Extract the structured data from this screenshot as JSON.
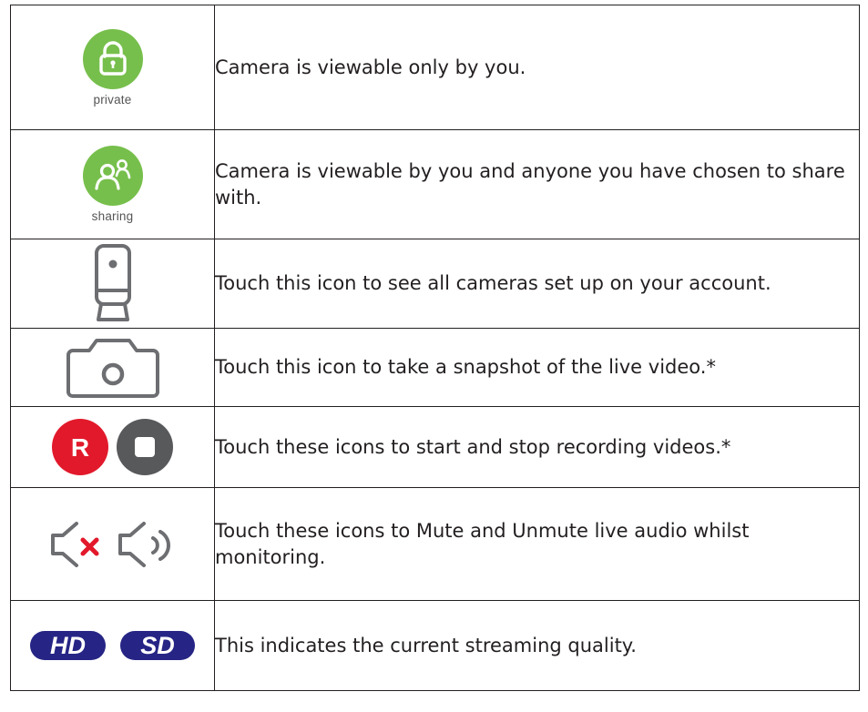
{
  "colors": {
    "green": "#77bf4c",
    "red": "#e2192b",
    "gray": "#6d6e71",
    "dark_gray": "#58595b",
    "navy": "#262585"
  },
  "rows": [
    {
      "icon": "lock-icon",
      "badge_label": "private",
      "description": "Camera is viewable only by you."
    },
    {
      "icon": "users-icon",
      "badge_label": "sharing",
      "description": "Camera is viewable by you and anyone you have chosen to share with."
    },
    {
      "icon": "camera-device-icon",
      "description": "Touch this icon to see all cameras set up on your account."
    },
    {
      "icon": "snapshot-icon",
      "description": "Touch this icon to take a snapshot of the live video.*"
    },
    {
      "icon": [
        "record-icon",
        "stop-icon"
      ],
      "record_letter": "R",
      "description": "Touch these icons to start and stop recording videos.*"
    },
    {
      "icon": [
        "mute-icon",
        "unmute-icon"
      ],
      "description": "Touch these icons to Mute and Unmute live audio whilst monitoring."
    },
    {
      "icon": [
        "hd-icon",
        "sd-icon"
      ],
      "hd_label": "HD",
      "sd_label": "SD",
      "description": "This indicates the current streaming quality."
    }
  ]
}
